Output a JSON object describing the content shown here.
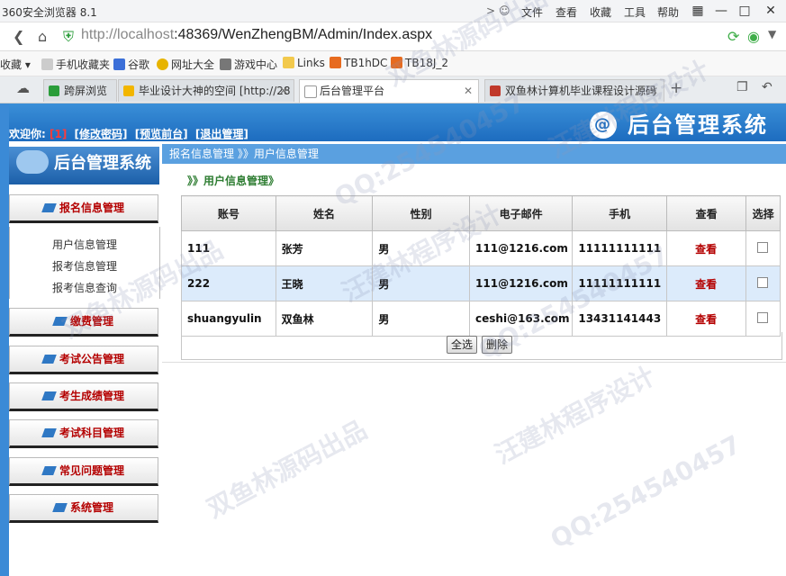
{
  "browser": {
    "title": "360安全浏览器 8.1",
    "menu": [
      "文件",
      "查看",
      "收藏",
      "工具",
      "帮助"
    ],
    "url_host": "http://localhost",
    "url_path": ":48369/WenZhengBM/Admin/Index.aspx",
    "bookmarks": [
      "收藏",
      "手机收藏夹",
      "谷歌",
      "网址大全",
      "游戏中心",
      "Links",
      "TB1hDC",
      "TB18J_2"
    ],
    "tabs": [
      {
        "label": "跨屏浏览"
      },
      {
        "label": "毕业设计大神的空间 [http://28"
      },
      {
        "label": "后台管理平台"
      },
      {
        "label": "双鱼林计算机毕业课程设计源码"
      }
    ]
  },
  "header": {
    "system_title": "后台管理系统",
    "welcome": "欢迎你:",
    "num": "[1]",
    "links": [
      "[修改密码]",
      "[预览前台]",
      "[退出管理]"
    ]
  },
  "sidebar": {
    "title": "后台管理系统",
    "sections": [
      {
        "label": "报名信息管理",
        "items": [
          "用户信息管理",
          "报考信息管理",
          "报考信息查询"
        ]
      },
      {
        "label": "缴费管理"
      },
      {
        "label": "考试公告管理"
      },
      {
        "label": "考生成绩管理"
      },
      {
        "label": "考试科目管理"
      },
      {
        "label": "常见问题管理"
      },
      {
        "label": "系统管理"
      }
    ]
  },
  "main": {
    "breadcrumb": "报名信息管理 》》用户信息管理",
    "section_title": "》》用户信息管理》",
    "columns": [
      "账号",
      "姓名",
      "性别",
      "电子邮件",
      "手机",
      "查看",
      "选择"
    ],
    "rows": [
      {
        "account": "111",
        "name": "张芳",
        "gender": "男",
        "email": "111@1216.com",
        "phone": "11111111111",
        "view": "查看"
      },
      {
        "account": "222",
        "name": "王晓",
        "gender": "男",
        "email": "111@1216.com",
        "phone": "11111111111",
        "view": "查看"
      },
      {
        "account": "shuangyulin",
        "name": "双鱼林",
        "gender": "男",
        "email": "ceshi@163.com",
        "phone": "13431141443",
        "view": "查看"
      }
    ],
    "select_all_label": "全选",
    "delete_label": "删除"
  },
  "watermarks": [
    "双鱼林源码出品",
    "QQ:254540457",
    "汪建林程序设计",
    "双鱼林源码出品",
    "QQ:254540457",
    "汪建林程序设计",
    "双鱼林源码出品",
    "QQ:254540457",
    "汪建林程序设计"
  ]
}
